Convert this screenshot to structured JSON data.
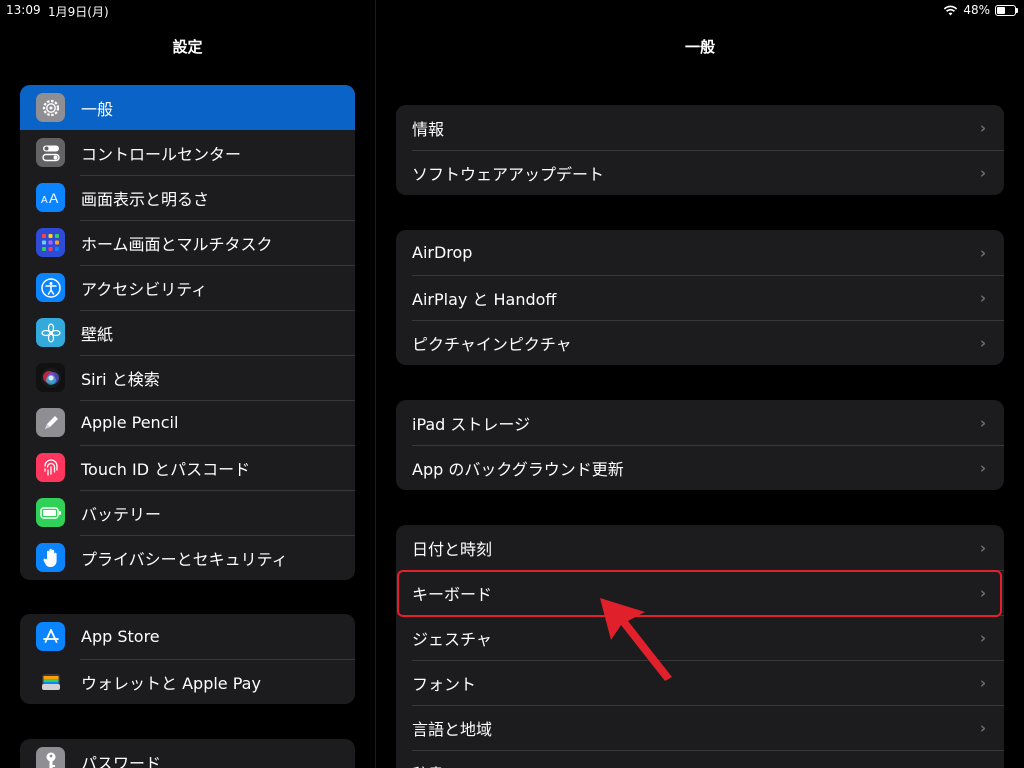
{
  "status_bar": {
    "time": "13:09",
    "date": "1月9日(月)",
    "battery": "48%",
    "battery_level": 0.48
  },
  "sidebar": {
    "title": "設定",
    "groups": [
      {
        "items": [
          {
            "label": "一般",
            "icon": "gear-icon",
            "color": "#8e8e93",
            "selected": true
          },
          {
            "label": "コントロールセンター",
            "icon": "control-center-icon",
            "color": "#636366"
          },
          {
            "label": "画面表示と明るさ",
            "icon": "display-aa-icon",
            "color": "#0a84ff"
          },
          {
            "label": "ホーム画面とマルチタスク",
            "icon": "home-screen-icon",
            "color": "#2f4bd6"
          },
          {
            "label": "アクセシビリティ",
            "icon": "accessibility-icon",
            "color": "#0a84ff"
          },
          {
            "label": "壁紙",
            "icon": "wallpaper-flower-icon",
            "color": "#34aadc"
          },
          {
            "label": "Siri と検索",
            "icon": "siri-icon",
            "color": "#111111"
          },
          {
            "label": "Apple Pencil",
            "icon": "pencil-icon",
            "color": "#8e8e93"
          },
          {
            "label": "Touch ID とパスコード",
            "icon": "fingerprint-icon",
            "color": "#ff375f"
          },
          {
            "label": "バッテリー",
            "icon": "battery-icon",
            "color": "#30d158"
          },
          {
            "label": "プライバシーとセキュリティ",
            "icon": "hand-icon",
            "color": "#0a84ff"
          }
        ]
      },
      {
        "items": [
          {
            "label": "App Store",
            "icon": "app-store-icon",
            "color": "#0a84ff"
          },
          {
            "label": "ウォレットと Apple Pay",
            "icon": "wallet-icon",
            "color": "#1c1c1e"
          }
        ]
      },
      {
        "items": [
          {
            "label": "パスワード",
            "icon": "key-icon",
            "color": "#8e8e93"
          }
        ]
      }
    ]
  },
  "main": {
    "title": "一般",
    "groups": [
      {
        "items": [
          {
            "label": "情報"
          },
          {
            "label": "ソフトウェアアップデート"
          }
        ]
      },
      {
        "items": [
          {
            "label": "AirDrop"
          },
          {
            "label": "AirPlay と Handoff"
          },
          {
            "label": "ピクチャインピクチャ"
          }
        ]
      },
      {
        "items": [
          {
            "label": "iPad ストレージ"
          },
          {
            "label": "App のバックグラウンド更新"
          }
        ]
      },
      {
        "items": [
          {
            "label": "日付と時刻"
          },
          {
            "label": "キーボード",
            "highlighted": true
          },
          {
            "label": "ジェスチャ"
          },
          {
            "label": "フォント"
          },
          {
            "label": "言語と地域"
          },
          {
            "label": "辞書"
          }
        ]
      }
    ]
  },
  "annotation": {
    "color": "#e0202a"
  }
}
